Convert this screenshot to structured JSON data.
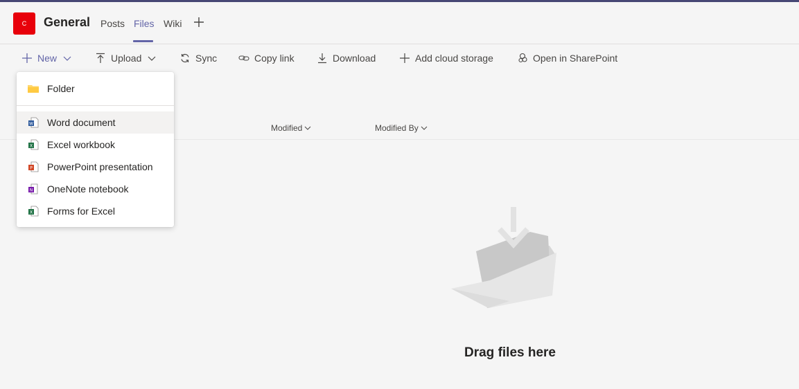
{
  "header": {
    "team_initial": "C",
    "channel_name": "General",
    "tabs": [
      {
        "label": "Posts",
        "active": false
      },
      {
        "label": "Files",
        "active": true
      },
      {
        "label": "Wiki",
        "active": false
      }
    ]
  },
  "toolbar": {
    "new_label": "New",
    "upload_label": "Upload",
    "sync_label": "Sync",
    "copy_link_label": "Copy link",
    "download_label": "Download",
    "add_cloud_label": "Add cloud storage",
    "sharepoint_label": "Open in SharePoint"
  },
  "columns": {
    "modified": "Modified",
    "modified_by": "Modified By"
  },
  "new_menu": {
    "items": [
      {
        "label": "Folder",
        "icon": "folder-icon"
      },
      {
        "label": "Word document",
        "icon": "word-icon"
      },
      {
        "label": "Excel workbook",
        "icon": "excel-icon"
      },
      {
        "label": "PowerPoint presentation",
        "icon": "powerpoint-icon"
      },
      {
        "label": "OneNote notebook",
        "icon": "onenote-icon"
      },
      {
        "label": "Forms for Excel",
        "icon": "forms-excel-icon"
      }
    ]
  },
  "empty_state": {
    "message": "Drag files here"
  },
  "colors": {
    "accent": "#6264a7",
    "team_avatar": "#e8000b",
    "word": "#2b579a",
    "excel": "#217346",
    "powerpoint": "#d24726",
    "onenote": "#7719aa",
    "folder": "#ffd66b"
  }
}
